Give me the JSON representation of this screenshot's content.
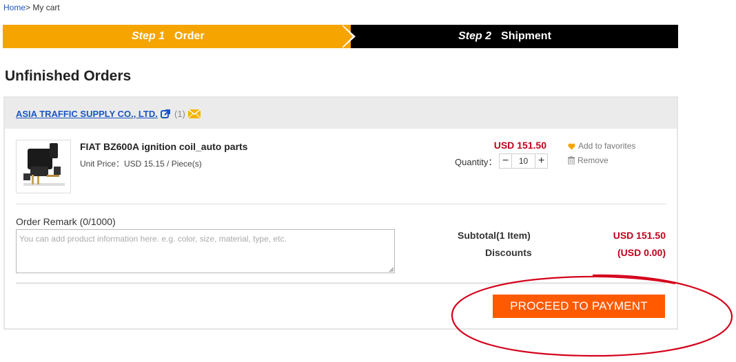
{
  "breadcrumb": {
    "home": "Home",
    "separator": ">",
    "current": "My cart"
  },
  "steps": [
    {
      "number": "Step 1",
      "label": "Order",
      "state": "active",
      "color": "#f5a400"
    },
    {
      "number": "Step 2",
      "label": "Shipment",
      "state": "inactive",
      "color": "#000000"
    }
  ],
  "page_title": "Unfinished Orders",
  "order": {
    "supplier": {
      "name": "ASIA TRAFFIC SUPPLY CO., LTD.",
      "count": "(1)",
      "icons": [
        "external-link-icon",
        "mail-icon"
      ]
    },
    "item": {
      "name": "FIAT BZ600A ignition coil_auto parts",
      "unit_price": "Unit Price：USD 15.15 / Piece(s)",
      "line_total": "USD 151.50",
      "quantity_label": "Quantity：",
      "quantity": "10",
      "add_to_favorites": "Add to favorites",
      "remove": "Remove"
    },
    "remark": {
      "label": "Order Remark (0/1000)",
      "placeholder": "You can add product information here. e.g. color, size, material, type, etc.",
      "value": ""
    },
    "summary": {
      "subtotal_label": "Subtotal(1 Item)",
      "subtotal_value": "USD 151.50",
      "discounts_label": "Discounts",
      "discounts_value": "(USD 0.00)"
    },
    "proceed_button": "PROCEED TO PAYMENT"
  },
  "colors": {
    "accent_orange": "#ff5a00",
    "step_active": "#f5a400",
    "price_red": "#c0001a",
    "link_blue": "#1a56c4",
    "annotation_red": "#d4001a"
  }
}
